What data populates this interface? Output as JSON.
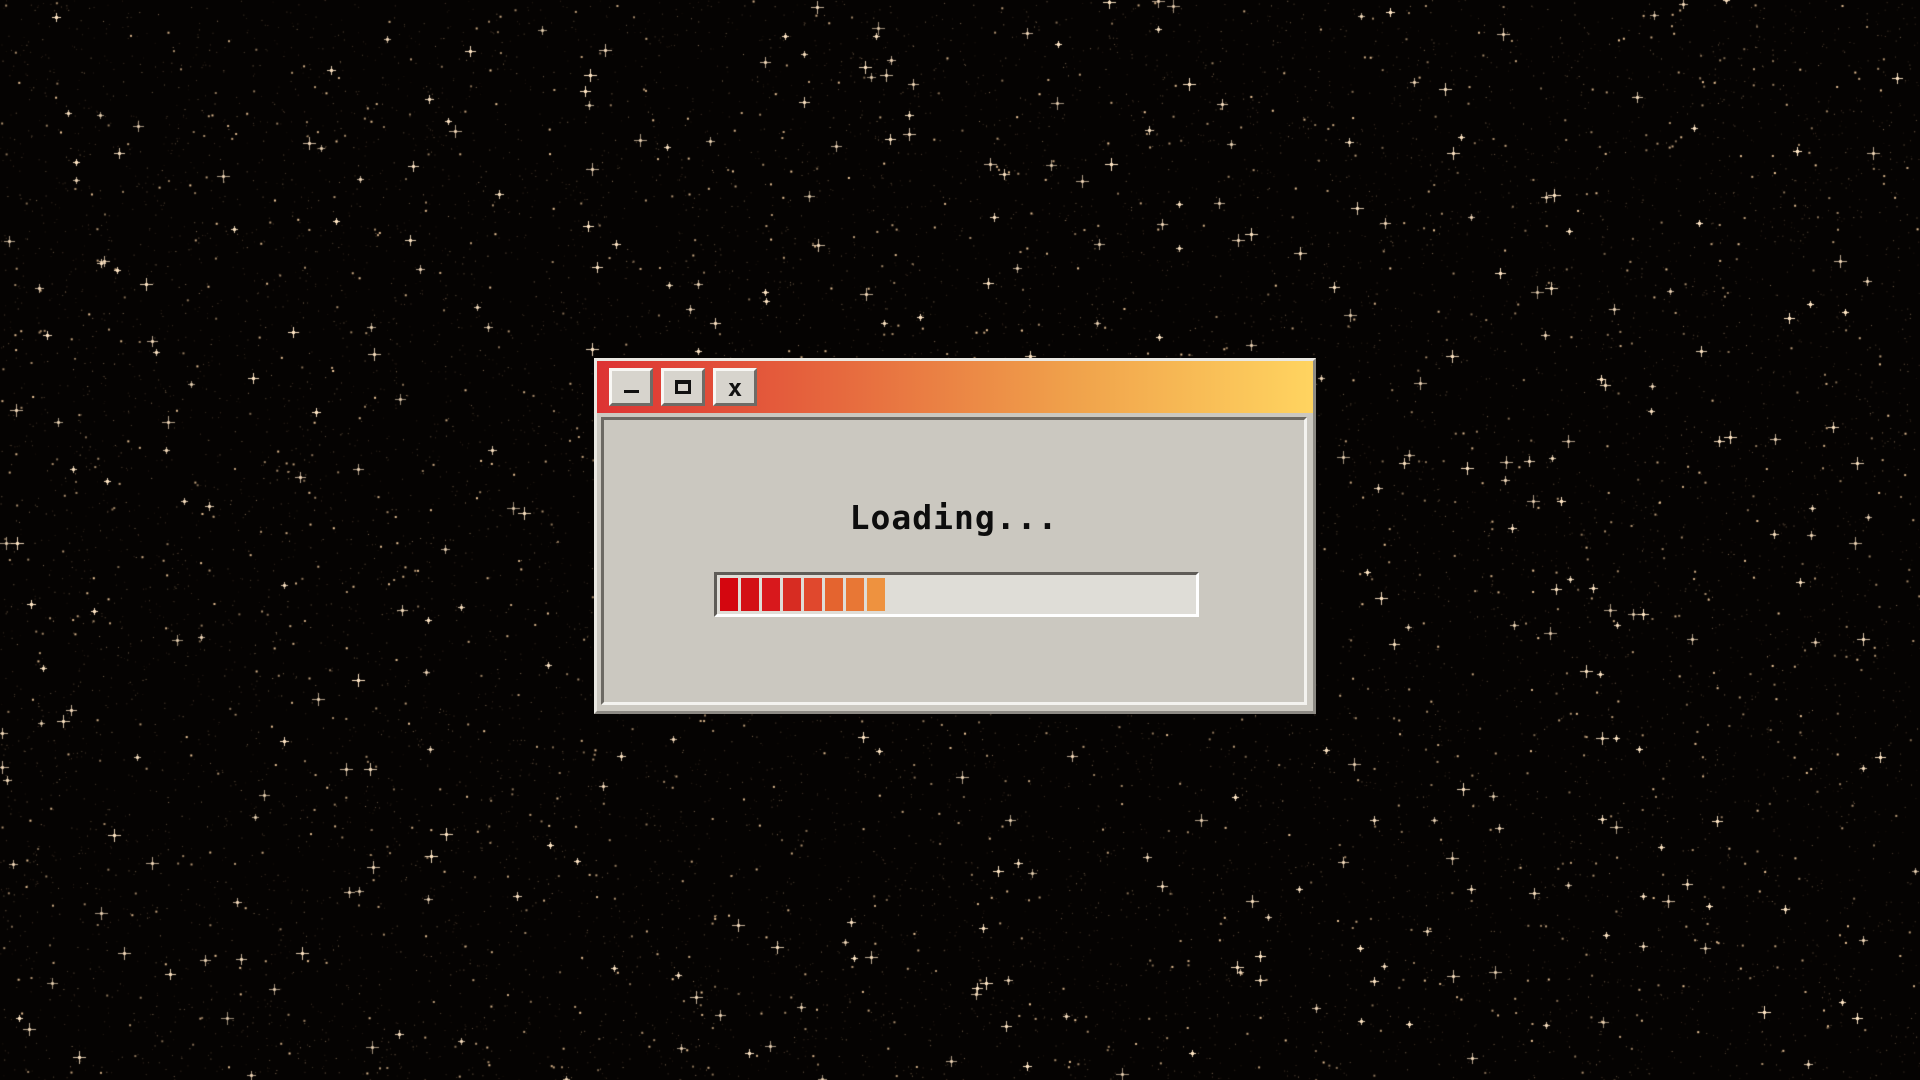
{
  "background": {
    "name": "starfield",
    "base_color": "#050302",
    "star_color": "#f2c99a"
  },
  "window": {
    "title_gradient": [
      "#dd3333",
      "#e6683e",
      "#f0a24b",
      "#ffd460"
    ],
    "buttons": {
      "minimize": {
        "icon": "minimize-icon"
      },
      "maximize": {
        "icon": "maximize-icon"
      },
      "close": {
        "icon": "close-icon",
        "glyph": "x"
      }
    },
    "body_color": "#cbc8c0"
  },
  "dialog": {
    "message": "Loading..."
  },
  "progress": {
    "value_percent": 34,
    "segments_filled": 8,
    "segment_colors": [
      "#d4060f",
      "#d30f15",
      "#d8181c",
      "#d72c22",
      "#e0482d",
      "#e4642f",
      "#e87735",
      "#ee923f"
    ]
  }
}
